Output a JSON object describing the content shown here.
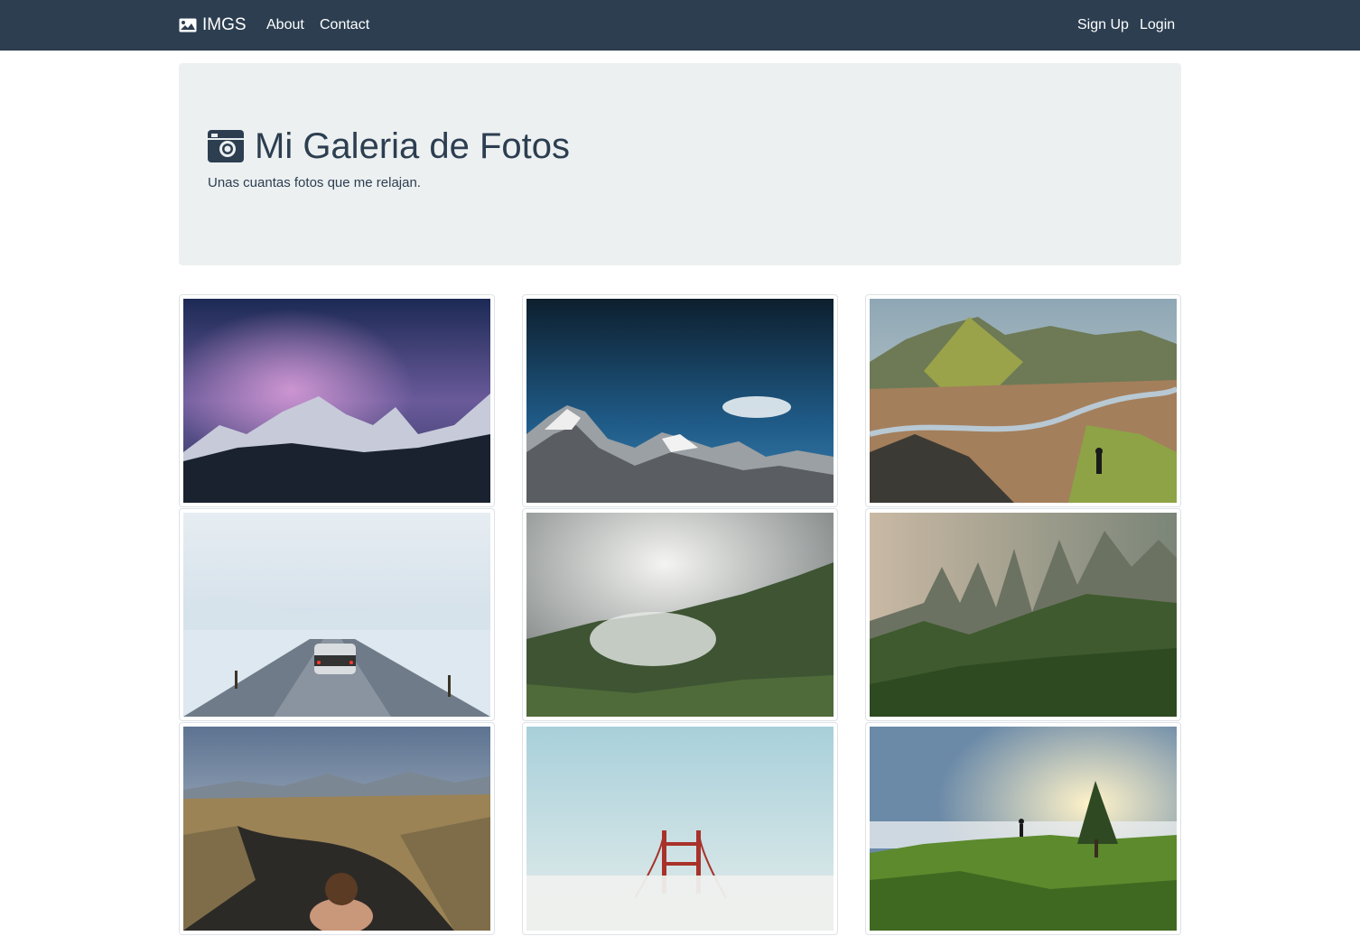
{
  "navbar": {
    "brand": "IMGS",
    "links": [
      "About",
      "Contact"
    ],
    "right_links": [
      "Sign Up",
      "Login"
    ]
  },
  "jumbotron": {
    "title": "Mi Galeria de Fotos",
    "lead": "Unas cuantas fotos que me relajan."
  },
  "gallery": {
    "photos": [
      {
        "subject": "milky-way-mountains"
      },
      {
        "subject": "snowy-peaks-blue-sky"
      },
      {
        "subject": "river-valley-hiker"
      },
      {
        "subject": "car-on-snowy-road"
      },
      {
        "subject": "foggy-green-hill"
      },
      {
        "subject": "misty-rock-pillars"
      },
      {
        "subject": "woman-in-hot-spring"
      },
      {
        "subject": "bridge-tower-in-fog"
      },
      {
        "subject": "sunrise-over-clouds-hiker"
      }
    ]
  },
  "colors": {
    "navbar": "#2c3e50",
    "jumbotron": "#ecf0f1",
    "text": "#2c3e50"
  }
}
